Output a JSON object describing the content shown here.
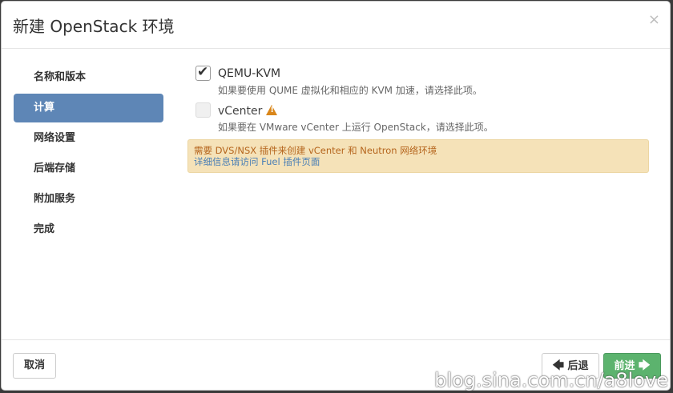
{
  "header": {
    "title": "新建 OpenStack 环境",
    "close_symbol": "×"
  },
  "sidebar": {
    "items": [
      {
        "label": "名称和版本",
        "active": false
      },
      {
        "label": "计算",
        "active": true
      },
      {
        "label": "网络设置",
        "active": false
      },
      {
        "label": "后端存储",
        "active": false
      },
      {
        "label": "附加服务",
        "active": false
      },
      {
        "label": "完成",
        "active": false
      }
    ]
  },
  "options": [
    {
      "label": "QEMU-KVM",
      "description": "如果要使用 QUME 虚拟化和相应的 KVM 加速，请选择此项。",
      "checked": true,
      "disabled": false
    },
    {
      "label": "vCenter",
      "description": "如果要在 VMware vCenter 上运行 OpenStack，请选择此项。",
      "checked": false,
      "disabled": true,
      "icon": "warning-icon"
    }
  ],
  "alert": {
    "text": "需要 DVS/NSX 插件来创建 vCenter 和 Neutron 网络环境",
    "link": "详细信息请访问 Fuel 插件页面"
  },
  "footer": {
    "cancel_label": "取消",
    "back_label": "后退",
    "next_label": "前进",
    "back_arrow": "🡄",
    "next_arrow": "🡆"
  },
  "watermark": "blog.sina.com.cn/a8love",
  "colors": {
    "active_nav": "#5e86b6",
    "next_button": "#5cb36e",
    "alert_bg": "#f5e2b8",
    "alert_text": "#b5651d",
    "alert_link": "#4a7fb5",
    "warning": "#d9861a"
  }
}
